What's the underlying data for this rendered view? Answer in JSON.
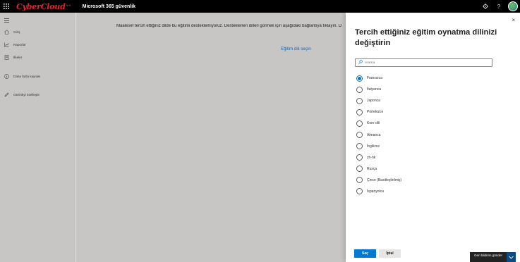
{
  "topbar": {
    "brand": "CyberCloud",
    "brand_suffix": "++",
    "app_title": "Microsoft 365 güvenlik",
    "settings_icon": "gear-icon",
    "help_icon": "question-icon",
    "help_label": "?"
  },
  "nav": {
    "items": [
      {
        "label": "Giriş",
        "icon": "home-icon"
      },
      {
        "label": "Raporlar",
        "icon": "chart-icon"
      },
      {
        "label": "İlkeler",
        "icon": "policy-icon"
      },
      {
        "label": "Daha fazla kaynak",
        "icon": "info-icon"
      },
      {
        "label": "Gezintiyi özelleştir",
        "icon": "pencil-icon"
      }
    ]
  },
  "main": {
    "message": "Maalesef tercih ettiğiniz dilde bu eğitimi desteklemiyoruz. Desteklenen dilleri görmek için aşağıdaki bağlantıya tıklayın. D",
    "link": "Eğitim dili seçin"
  },
  "panel": {
    "title": "Tercih ettiğiniz eğitim oynatma dilinizi değiştirin",
    "search_placeholder": "Arama",
    "options": [
      {
        "label": "Fransızca",
        "checked": true
      },
      {
        "label": "İtalyanca",
        "checked": false
      },
      {
        "label": "Japonca",
        "checked": false
      },
      {
        "label": "Portekizce",
        "checked": false
      },
      {
        "label": "Kore dili",
        "checked": false
      },
      {
        "label": "Almanca",
        "checked": false
      },
      {
        "label": "İngilizce",
        "checked": false
      },
      {
        "label": "zh-hk",
        "checked": false
      },
      {
        "label": "Rusça",
        "checked": false
      },
      {
        "label": "Çince (Basitleştirilmiş)",
        "checked": false
      },
      {
        "label": "İspanyolca",
        "checked": false
      }
    ],
    "select_label": "Seç",
    "cancel_label": "İptal",
    "close_label": "×"
  },
  "feedback": {
    "label": "Geri bildirim gönder"
  },
  "colors": {
    "accent": "#0078d4",
    "brand": "#e8232a",
    "topbar": "#000000"
  }
}
